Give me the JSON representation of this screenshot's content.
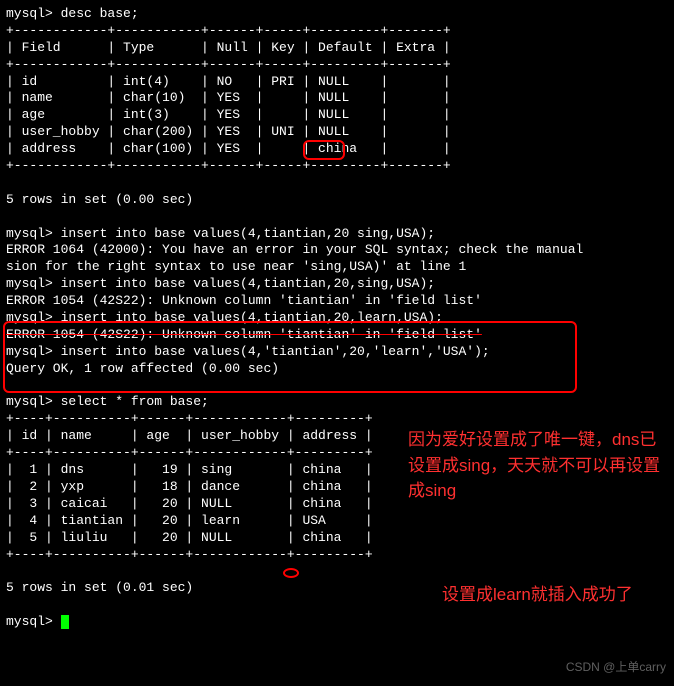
{
  "cmd_desc": "mysql> desc base;",
  "border1": "+------------+-----------+------+-----+---------+-------+",
  "header": "| Field      | Type      | Null | Key | Default | Extra |",
  "desc_rows": [
    "| id         | int(4)    | NO   | PRI | NULL    |       |",
    "| name       | char(10)  | YES  |     | NULL    |       |",
    "| age        | int(3)    | YES  |     | NULL    |       |",
    "| user_hobby | char(200) | YES  | UNI | NULL    |       |",
    "| address    | char(100) | YES  |     | china   |       |"
  ],
  "summary1": "5 rows in set (0.00 sec)",
  "ins1": "mysql> insert into base values(4,tiantian,20 sing,USA);",
  "err1a": "ERROR 1064 (42000): You have an error in your SQL syntax; check the manual ",
  "err1b": "sion for the right syntax to use near 'sing,USA)' at line 1",
  "ins2": "mysql> insert into base values(4,tiantian,20,sing,USA);",
  "err2": "ERROR 1054 (42S22): Unknown column 'tiantian' in 'field list'",
  "ins3": "mysql> insert into base values(4,tiantian,20,learn,USA);",
  "err3": "ERROR 1054 (42S22): Unknown column 'tiantian' in 'field list'",
  "ins4": "mysql> insert into base values(4,'tiantian',20,'learn','USA');",
  "ok": "Query OK, 1 row affected (0.00 sec)",
  "cmd_select": "mysql> select * from base;",
  "border2": "+----+----------+------+------------+---------+",
  "header2": "| id | name     | age  | user_hobby | address |",
  "data_rows": [
    "|  1 | dns      |   19 | sing       | china   |",
    "|  2 | yxp      |   18 | dance      | china   |",
    "|  3 | caicai   |   20 | NULL       | china   |",
    "|  4 | tiantian |   20 | learn      | USA     |",
    "|  5 | liuliu   |   20 | NULL       | china   |"
  ],
  "summary2": "5 rows in set (0.01 sec)",
  "prompt_final": "mysql> ",
  "annotation1": "因为爱好设置成了唯一键，dns已设置成sing，天天就不可以再设置成sing",
  "annotation2": "设置成learn就插入成功了",
  "watermark": "CSDN @上单carry"
}
